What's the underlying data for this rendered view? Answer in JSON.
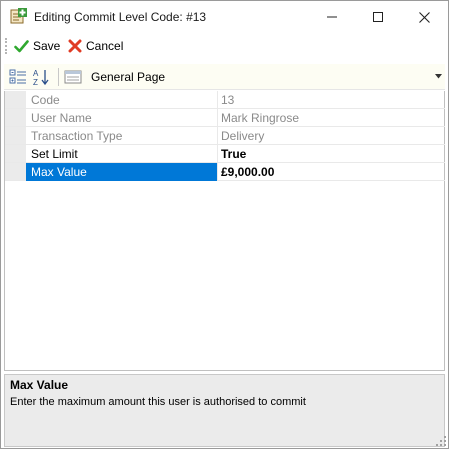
{
  "window": {
    "title": "Editing Commit Level Code: #13",
    "icon": "commit-level-icon",
    "caption_buttons": [
      "minimize-icon",
      "maximize-icon",
      "close-icon"
    ]
  },
  "toolbar": {
    "save_label": "Save",
    "cancel_label": "Cancel"
  },
  "grid_toolbar": {
    "categorized_icon": "categorized-view-icon",
    "alphabetical_icon": "alphabetical-sort-icon",
    "page_icon": "property-page-icon",
    "page_label": "General Page"
  },
  "properties": [
    {
      "name": "Code",
      "value": "13",
      "editable": false
    },
    {
      "name": "User Name",
      "value": "Mark Ringrose",
      "editable": false
    },
    {
      "name": "Transaction Type",
      "value": "Delivery",
      "editable": false
    },
    {
      "name": "Set Limit",
      "value": "True",
      "editable": true
    },
    {
      "name": "Max Value",
      "value": "£9,000.00",
      "editable": true,
      "selected": true
    }
  ],
  "help": {
    "title": "Max Value",
    "description": "Enter the maximum amount this user is authorised to commit"
  },
  "colors": {
    "selection": "#0078d7",
    "readonly_text": "#8a8a8a",
    "save_check": "#2fa82f",
    "cancel_x": "#e03b24"
  }
}
